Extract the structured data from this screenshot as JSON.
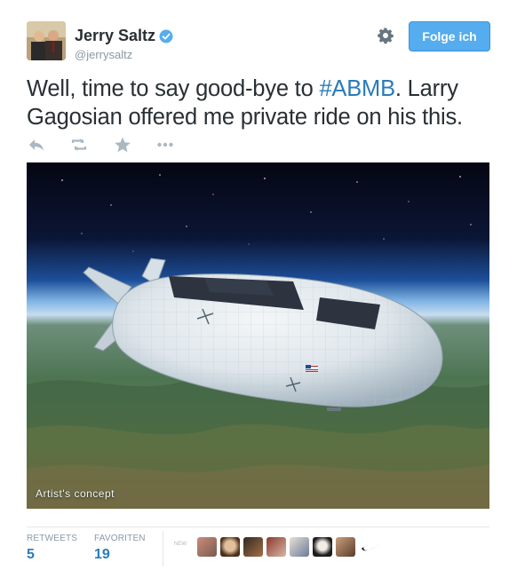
{
  "user": {
    "display_name": "Jerry Saltz",
    "handle": "@jerrysaltz",
    "avatar_icon": "user-avatar",
    "verified_icon": "verified-badge-icon"
  },
  "follow_button": {
    "label": "Folge ich"
  },
  "tweet": {
    "text_before": "Well, time to say good-bye to ",
    "hashtag": "#ABMB",
    "text_after": ". Larry Gagosian offered me private ride on his this."
  },
  "actions": [
    {
      "name": "reply",
      "icon": "reply-icon"
    },
    {
      "name": "retweet",
      "icon": "retweet-icon"
    },
    {
      "name": "favorite",
      "icon": "star-icon"
    },
    {
      "name": "more",
      "icon": "more-dots-icon"
    }
  ],
  "media": {
    "caption": "Artist's concept",
    "description_icon": "airship-image"
  },
  "stats": {
    "retweets_label": "RETWEETS",
    "retweets_value": "5",
    "favorites_label": "FAVORITEN",
    "favorites_value": "19"
  },
  "faves_label": "NEW",
  "colors": {
    "accent": "#55acee",
    "link": "#2b7bb9",
    "text": "#292f33",
    "muted": "#8899a6"
  }
}
